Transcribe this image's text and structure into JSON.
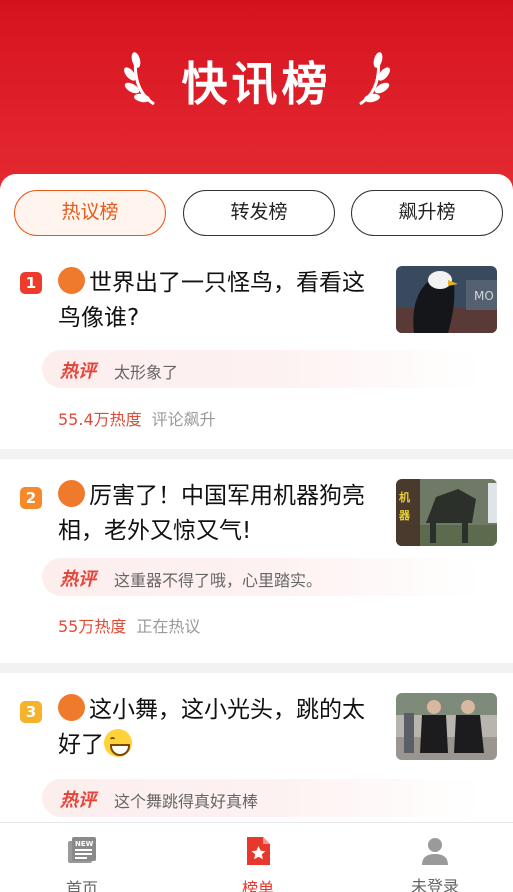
{
  "header": {
    "title": "快讯榜"
  },
  "tabs": [
    {
      "label": "热议榜",
      "active": true
    },
    {
      "label": "转发榜",
      "active": false
    },
    {
      "label": "飙升榜",
      "active": false
    }
  ],
  "items": [
    {
      "rank": "1",
      "headline": "世界出了一只怪鸟，看看这鸟像谁?",
      "comment_tag": "热评",
      "comment": "太形象了",
      "heat": "55.4万热度",
      "status": "评论飙升"
    },
    {
      "rank": "2",
      "headline": "厉害了！中国军用机器狗亮相，老外又惊又气!",
      "comment_tag": "热评",
      "comment": "这重器不得了哦，心里踏实。",
      "heat": "55万热度",
      "status": "正在热议"
    },
    {
      "rank": "3",
      "headline": "这小舞，这小光头，跳的太好了",
      "comment_tag": "热评",
      "comment": "这个舞跳得真好真棒"
    }
  ],
  "nav": [
    {
      "label": "首页",
      "icon": "newspaper-icon",
      "active": false
    },
    {
      "label": "榜单",
      "icon": "star-document-icon",
      "active": true
    },
    {
      "label": "未登录",
      "icon": "user-icon",
      "active": false
    }
  ],
  "colors": {
    "accent": "#e8372c",
    "header": "#d4121e",
    "tab_active": "#e85a1c"
  }
}
